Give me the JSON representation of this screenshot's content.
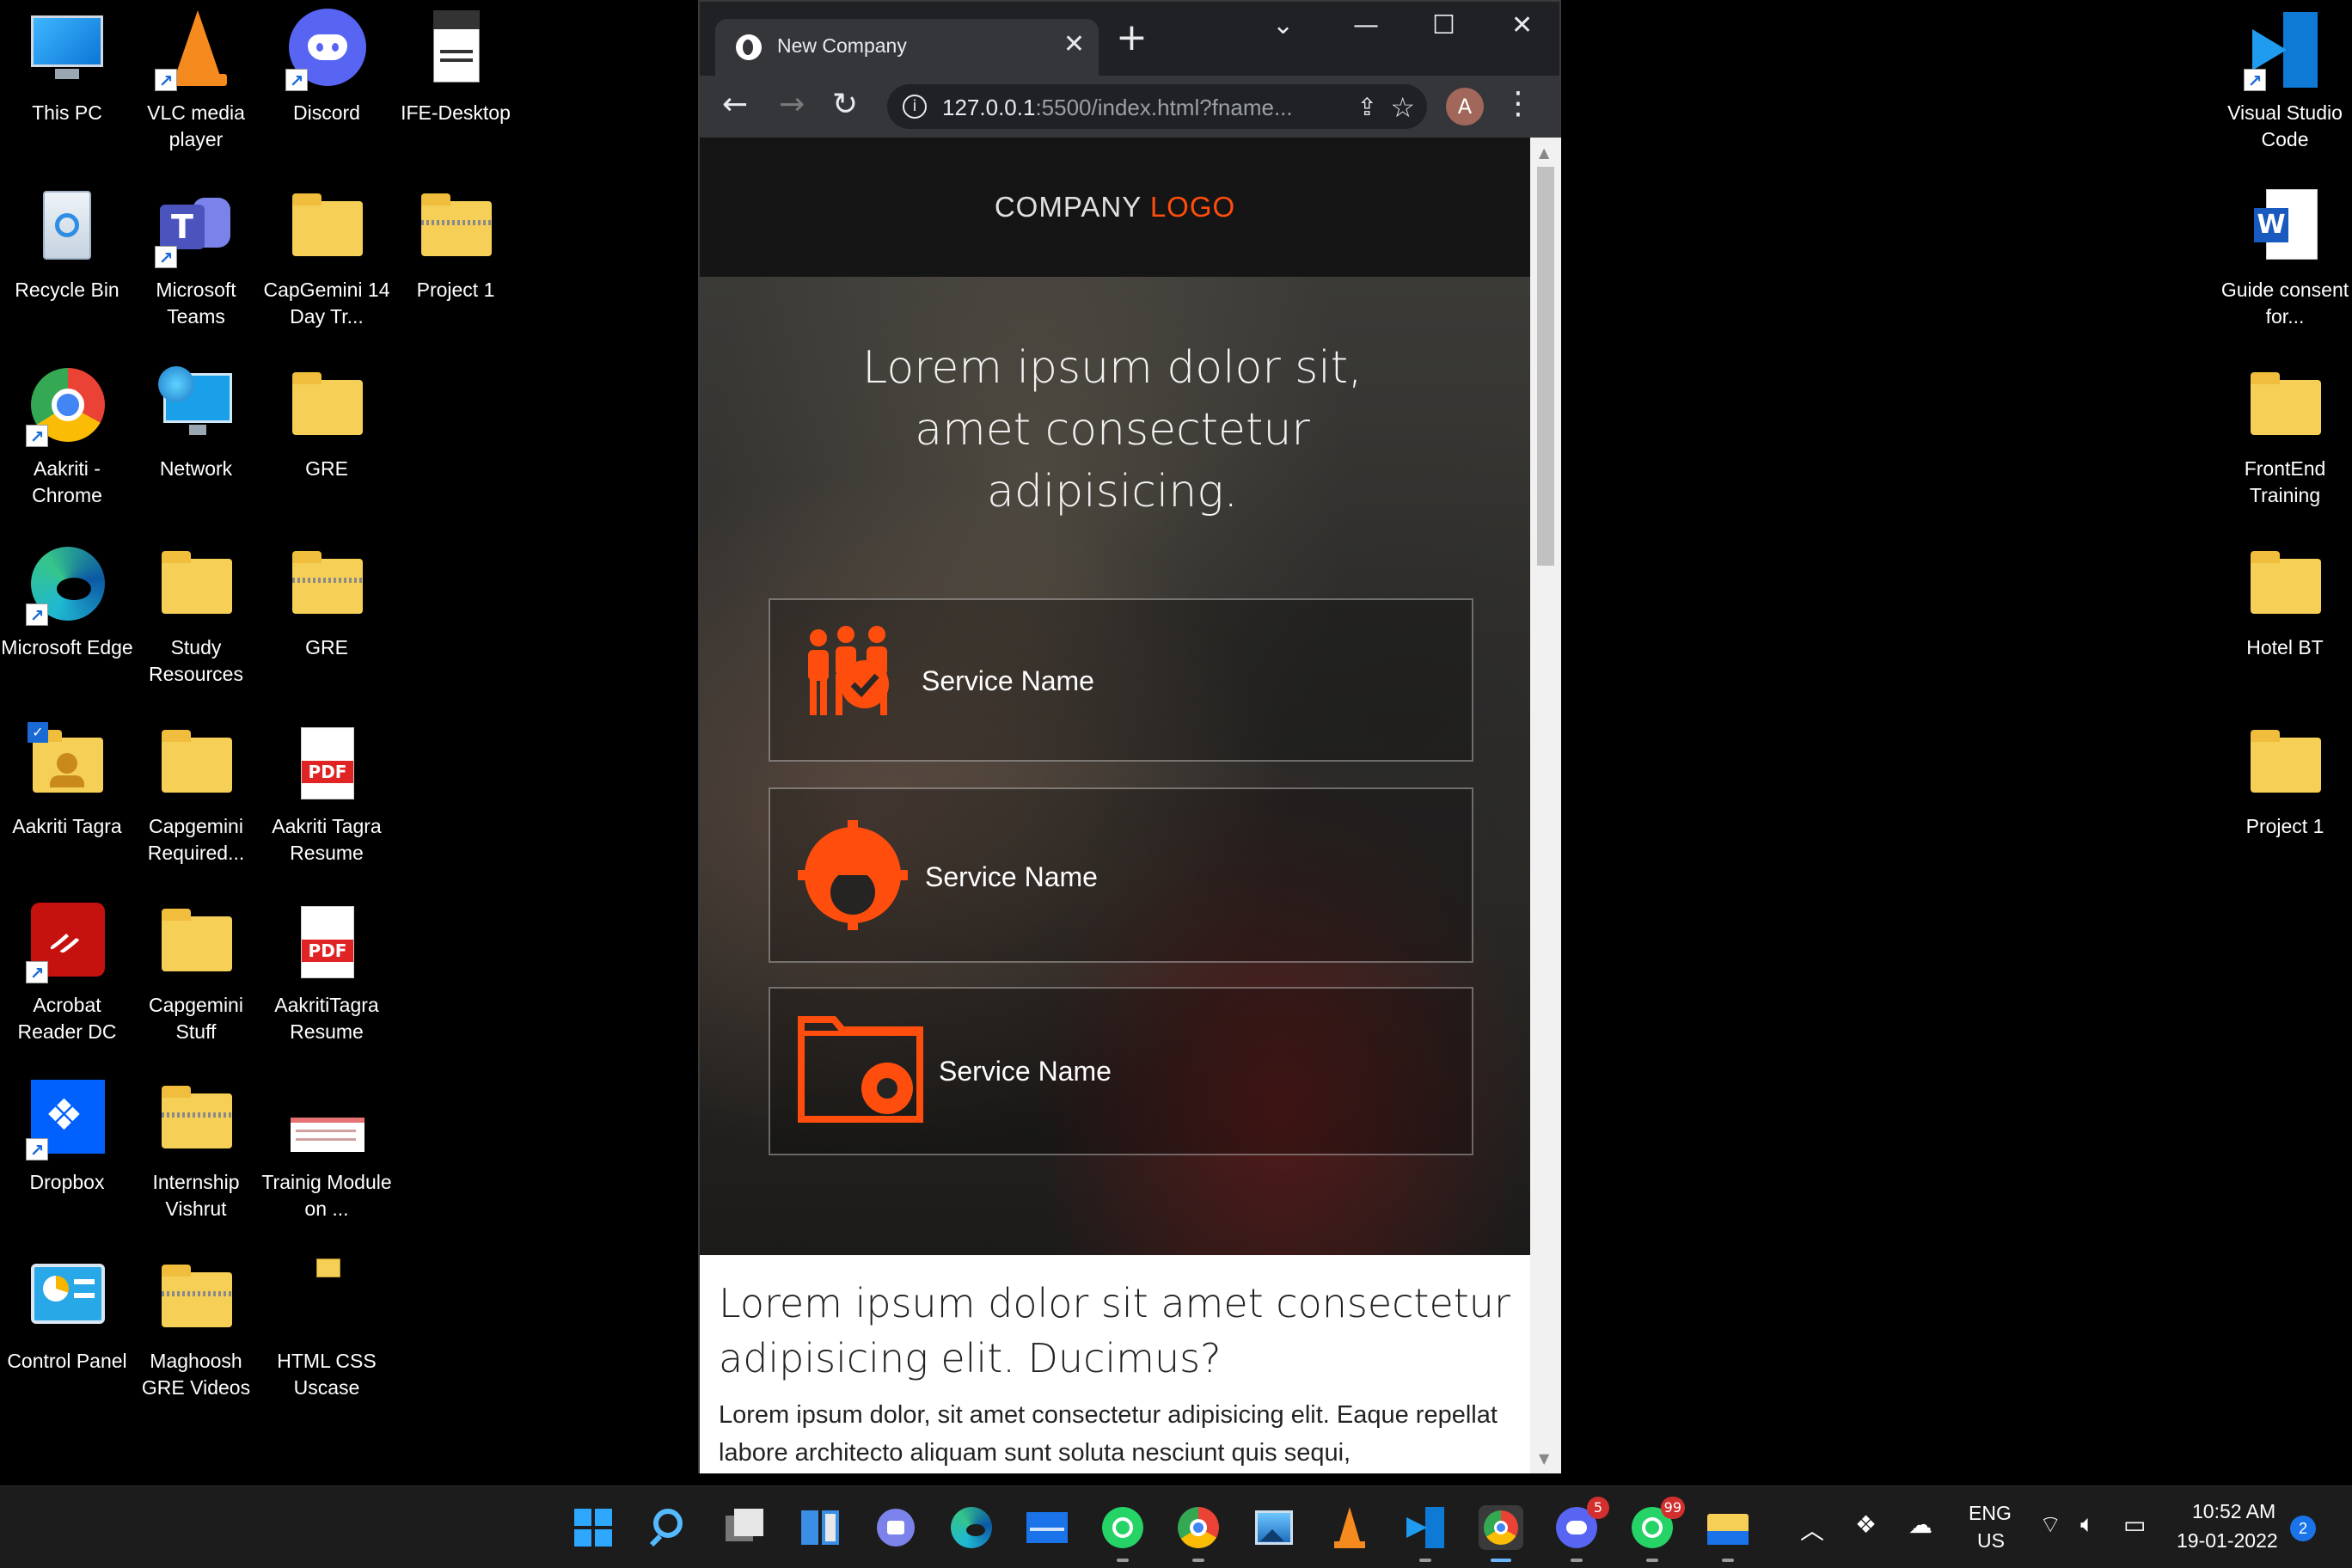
{
  "desktop": {
    "icons": [
      {
        "label": "This PC"
      },
      {
        "label": "VLC media player"
      },
      {
        "label": "Discord"
      },
      {
        "label": "IFE-Desktop"
      },
      {
        "label": "Recycle Bin"
      },
      {
        "label": "Microsoft Teams"
      },
      {
        "label": "CapGemini 14 Day Tr..."
      },
      {
        "label": "Project 1"
      },
      {
        "label": "Aakriti - Chrome"
      },
      {
        "label": "Network"
      },
      {
        "label": "GRE"
      },
      {
        "label": "Microsoft Edge"
      },
      {
        "label": "Study Resources"
      },
      {
        "label": "GRE"
      },
      {
        "label": "Aakriti Tagra"
      },
      {
        "label": "Capgemini Required..."
      },
      {
        "label": "Aakriti Tagra Resume"
      },
      {
        "label": "Acrobat Reader DC"
      },
      {
        "label": "Capgemini Stuff"
      },
      {
        "label": "AakritiTagra Resume"
      },
      {
        "label": "Dropbox"
      },
      {
        "label": "Internship Vishrut"
      },
      {
        "label": "Trainig Module on ..."
      },
      {
        "label": "Control Panel"
      },
      {
        "label": "Maghoosh GRE Videos"
      },
      {
        "label": "HTML CSS Uscase"
      },
      {
        "label": "Visual Studio Code"
      },
      {
        "label": "Guide consent for..."
      },
      {
        "label": "FrontEnd Training"
      },
      {
        "label": "Hotel BT"
      },
      {
        "label": "Project 1"
      }
    ],
    "pdf_badge": "PDF"
  },
  "browser": {
    "tab_title": "New Company",
    "tab_close": "✕",
    "new_tab": "+",
    "window_controls": {
      "dropdown": "⌄",
      "minimize": "—",
      "maximize": "☐",
      "close": "✕"
    },
    "nav": {
      "back": "←",
      "forward": "→",
      "reload": "↻"
    },
    "url_host": "127.0.0.1",
    "url_rest": ":5500/index.html?fname...",
    "profile_initial": "A",
    "menu": "⋮"
  },
  "page": {
    "logo_main": "COMPANY",
    "logo_accent": "LOGO",
    "hero_title": "Lorem ipsum dolor sit, amet consectetur adipisicing.",
    "services": [
      {
        "name": "Service Name",
        "icon": "team-check-icon"
      },
      {
        "name": "Service Name",
        "icon": "team-gear-icon"
      },
      {
        "name": "Service Name",
        "icon": "folder-gear-icon"
      }
    ],
    "content_heading": "Lorem ipsum dolor sit amet consectetur adipisicing elit. Ducimus?",
    "content_body": "Lorem ipsum dolor, sit amet consectetur adipisicing elit. Eaque repellat labore architecto aliquam sunt soluta nesciunt quis sequi,",
    "accent_color": "#ff4d0d"
  },
  "taskbar": {
    "apps": [
      "Start",
      "Search",
      "Task View",
      "Widgets",
      "Chat",
      "Microsoft Edge",
      "Mail",
      "WhatsApp",
      "Chrome",
      "Photos",
      "VLC",
      "Visual Studio Code",
      "Chrome Profile",
      "Discord",
      "WhatsApp Beta",
      "File Explorer"
    ],
    "discord_badge": "5",
    "whatsapp_badge": "99",
    "language_top": "ENG",
    "language_bottom": "US",
    "time": "10:52 AM",
    "date": "19-01-2022",
    "notification_count": "2"
  }
}
